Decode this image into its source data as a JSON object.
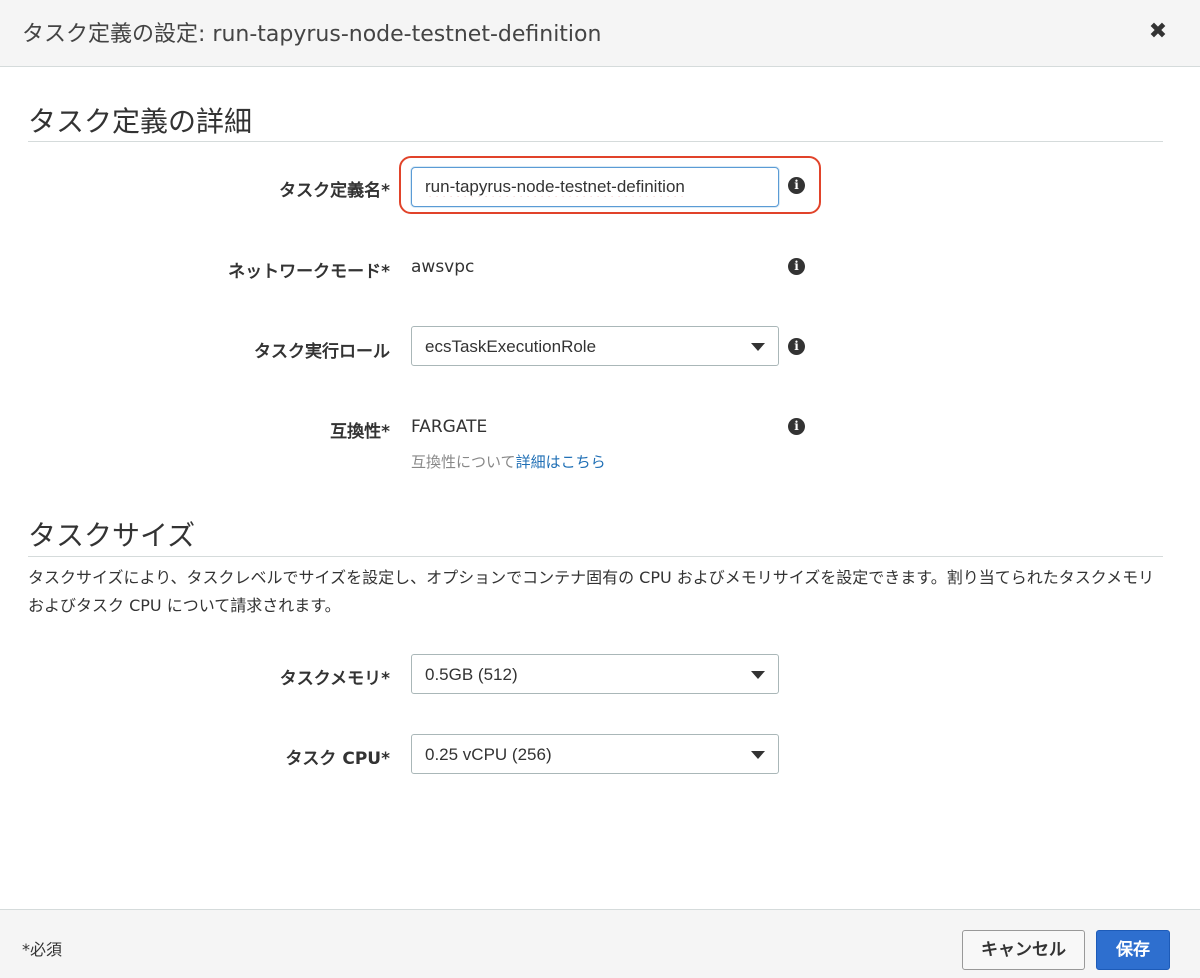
{
  "dialog": {
    "title": "タスク定義の設定: run-tapyrus-node-testnet-definition",
    "close_label": "✖"
  },
  "details_section": {
    "title": "タスク定義の詳細",
    "task_definition_name": {
      "label": "タスク定義名*",
      "value": "run-tapyrus-node-testnet-definition",
      "info_icon": "info-circle-icon"
    },
    "network_mode": {
      "label": "ネットワークモード*",
      "value": "awsvpc",
      "info_icon": "info-circle-icon"
    },
    "task_execution_role": {
      "label": "タスク実行ロール",
      "selected": "ecsTaskExecutionRole",
      "info_icon": "info-circle-icon"
    },
    "compatibility": {
      "label": "互換性*",
      "value": "FARGATE",
      "help_prefix": "互換性について",
      "help_link": "詳細はこちら",
      "info_icon": "info-circle-icon"
    }
  },
  "size_section": {
    "title": "タスクサイズ",
    "description": "タスクサイズにより、タスクレベルでサイズを設定し、オプションでコンテナ固有の CPU およびメモリサイズを設定できます。割り当てられたタスクメモリおよびタスク CPU について請求されます。",
    "task_memory": {
      "label": "タスクメモリ*",
      "selected": "0.5GB (512)"
    },
    "task_cpu": {
      "label": "タスク CPU*",
      "selected": "0.25 vCPU (256)"
    }
  },
  "footer": {
    "required_note": "*必須",
    "cancel_label": "キャンセル",
    "save_label": "保存"
  },
  "colors": {
    "highlight": "#e1432a",
    "primary_button": "#2e6fcf",
    "link": "#1f6fb5"
  }
}
